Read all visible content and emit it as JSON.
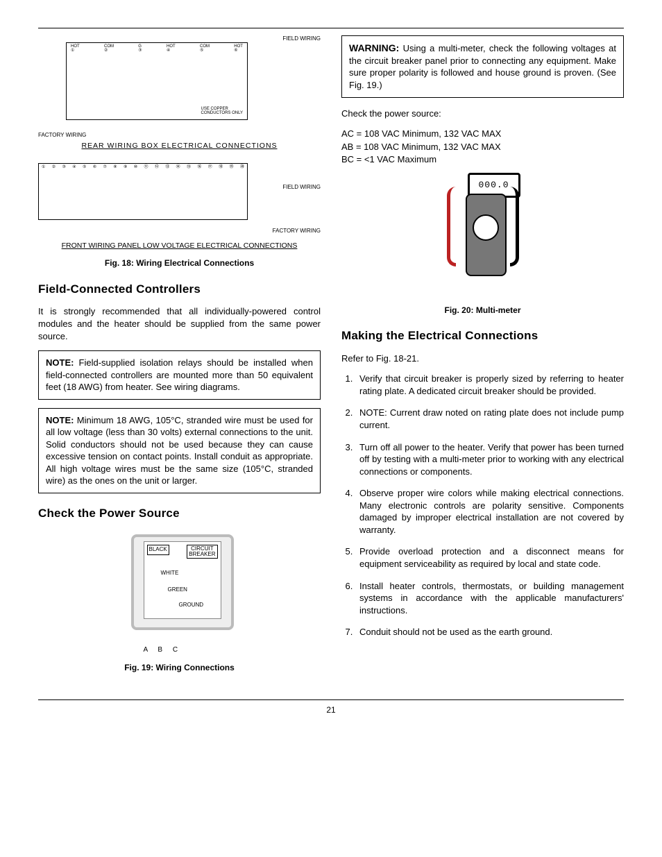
{
  "page_number": "21",
  "fig18": {
    "label_field_wiring": "FIELD WIRING",
    "label_factory_wiring": "FACTORY WIRING",
    "rear_caption": "REAR WIRING BOX ELECTRICAL CONNECTIONS",
    "front_caption": "FRONT WIRING PANEL LOW VOLTAGE ELECTRICAL CONNECTIONS",
    "main_caption": "Fig. 18: Wiring Electrical Connections"
  },
  "left": {
    "h_field_controllers": "Field-Connected Controllers",
    "p_field_controllers": "It is strongly recommended that all individually-powered control modules and the heater should be supplied from the same power source.",
    "note1_label": "NOTE:",
    "note1_body": " Field-supplied isolation relays should be installed when field-connected controllers are mounted more than 50 equivalent feet (18 AWG) from heater.  See wiring diagrams.",
    "note2_label": "NOTE:",
    "note2_body": " Minimum 18 AWG, 105°C, stranded wire must be used for all low voltage (less than 30 volts) external connections to the unit. Solid conductors should not be used because they can cause excessive tension on contact points. Install conduit as appropriate. All high voltage wires must be the same size (105°C, stranded wire) as the ones on the unit or larger.",
    "h_check_power": "Check the Power Source",
    "fig19_caption": "Fig. 19: Wiring Connections",
    "fig19_labels": {
      "black": "BLACK",
      "circuit_breaker": "CIRCUIT BREAKER",
      "white": "WHITE",
      "green": "GREEN",
      "ground": "GROUND",
      "abc": "A   B   C"
    }
  },
  "right": {
    "warning_label": "WARNING:",
    "warning_body": " Using a multi-meter, check the following voltages at the circuit breaker panel prior to connecting any equipment. Make sure proper polarity is followed and house ground is proven. (See Fig. 19.)",
    "p_check_source": "Check the power source:",
    "volt_ac": "AC = 108 VAC Minimum, 132 VAC MAX",
    "volt_ab": "AB = 108 VAC Minimum, 132 VAC MAX",
    "volt_bc": "BC = <1 VAC Maximum",
    "meter_reading": "000.0",
    "fig20_caption": "Fig. 20: Multi-meter",
    "h_making": "Making the Electrical Connections",
    "p_refer": "Refer to Fig. 18-21.",
    "steps": [
      "Verify that circuit breaker is properly sized by referring to heater rating plate. A dedicated circuit breaker should be provided.",
      "NOTE: Current draw noted on rating plate does not include pump current.",
      "Turn off all power to the heater. Verify that power has been turned off by testing with a multi-meter prior to working with any electrical connections or components.",
      "Observe proper wire colors while making electrical connections. Many electronic controls are polarity sensitive. Components damaged by improper electrical installation are not covered by warranty.",
      "Provide overload protection and a disconnect means for equipment serviceability as required by local and state code.",
      "Install heater controls, thermostats, or building management systems in accordance with the applicable manufacturers' instructions.",
      "Conduit should not be used as the earth ground."
    ]
  }
}
